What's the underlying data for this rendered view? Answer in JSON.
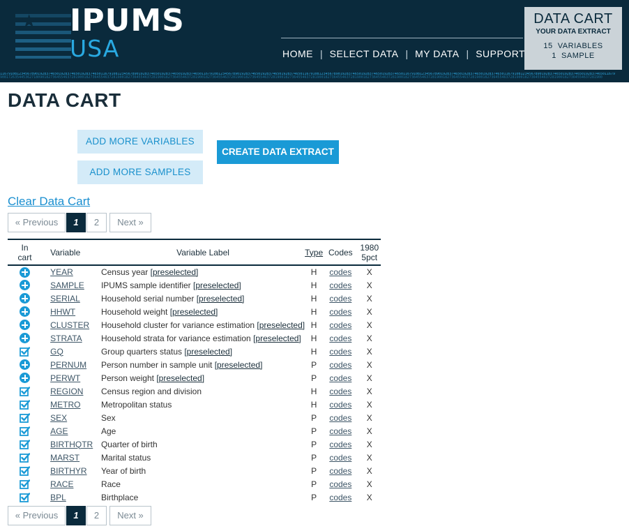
{
  "header": {
    "logo_title": "IPUMS",
    "logo_sub": "USA",
    "nav": [
      "HOME",
      "SELECT DATA",
      "MY DATA",
      "SUPPORT"
    ],
    "cart_box": {
      "title": "DATA CART",
      "subtitle": "YOUR DATA EXTRACT",
      "variables_count": "15",
      "variables_label": "VARIABLES",
      "samples_count": "1",
      "samples_label": "SAMPLE"
    }
  },
  "page": {
    "title": "DATA CART",
    "buttons": {
      "add_variables": "ADD MORE VARIABLES",
      "add_samples": "ADD MORE SAMPLES",
      "create_extract": "CREATE DATA EXTRACT"
    },
    "clear_cart": "Clear Data Cart",
    "pager": {
      "prev": "« Previous",
      "current": "1",
      "page2": "2",
      "next": "Next »"
    }
  },
  "table": {
    "headers": {
      "in_cart_1": "In",
      "in_cart_2": "cart",
      "variable": "Variable",
      "label": "Variable Label",
      "type": "Type",
      "codes": "Codes",
      "sample_1": "1980",
      "sample_2": "5pct"
    },
    "rows": [
      {
        "status": "add",
        "name": "YEAR",
        "label": "Census year",
        "preselected": "[preselected]",
        "type": "H",
        "codes": "codes",
        "sample": "X"
      },
      {
        "status": "add",
        "name": "SAMPLE",
        "label": "IPUMS sample identifier",
        "preselected": "[preselected]",
        "type": "H",
        "codes": "codes",
        "sample": "X"
      },
      {
        "status": "add",
        "name": "SERIAL",
        "label": "Household serial number",
        "preselected": "[preselected]",
        "type": "H",
        "codes": "codes",
        "sample": "X"
      },
      {
        "status": "add",
        "name": "HHWT",
        "label": "Household weight",
        "preselected": "[preselected]",
        "type": "H",
        "codes": "codes",
        "sample": "X"
      },
      {
        "status": "add",
        "name": "CLUSTER",
        "label": "Household cluster for variance estimation",
        "preselected": "[preselected]",
        "type": "H",
        "codes": "codes",
        "sample": "X"
      },
      {
        "status": "add",
        "name": "STRATA",
        "label": "Household strata for variance estimation",
        "preselected": "[preselected]",
        "type": "H",
        "codes": "codes",
        "sample": "X"
      },
      {
        "status": "check",
        "name": "GQ",
        "label": "Group quarters status",
        "preselected": "[preselected]",
        "type": "H",
        "codes": "codes",
        "sample": "X"
      },
      {
        "status": "add",
        "name": "PERNUM",
        "label": "Person number in sample unit",
        "preselected": "[preselected]",
        "type": "P",
        "codes": "codes",
        "sample": "X"
      },
      {
        "status": "add",
        "name": "PERWT",
        "label": "Person weight",
        "preselected": "[preselected]",
        "type": "P",
        "codes": "codes",
        "sample": "X"
      },
      {
        "status": "check",
        "name": "REGION",
        "label": "Census region and division",
        "preselected": "",
        "type": "H",
        "codes": "codes",
        "sample": "X"
      },
      {
        "status": "check",
        "name": "METRO",
        "label": "Metropolitan status",
        "preselected": "",
        "type": "H",
        "codes": "codes",
        "sample": "X"
      },
      {
        "status": "check",
        "name": "SEX",
        "label": "Sex",
        "preselected": "",
        "type": "P",
        "codes": "codes",
        "sample": "X"
      },
      {
        "status": "check",
        "name": "AGE",
        "label": "Age",
        "preselected": "",
        "type": "P",
        "codes": "codes",
        "sample": "X"
      },
      {
        "status": "check",
        "name": "BIRTHQTR",
        "label": "Quarter of birth",
        "preselected": "",
        "type": "P",
        "codes": "codes",
        "sample": "X"
      },
      {
        "status": "check",
        "name": "MARST",
        "label": "Marital status",
        "preselected": "",
        "type": "P",
        "codes": "codes",
        "sample": "X"
      },
      {
        "status": "check",
        "name": "BIRTHYR",
        "label": "Year of birth",
        "preselected": "",
        "type": "P",
        "codes": "codes",
        "sample": "X"
      },
      {
        "status": "check",
        "name": "RACE",
        "label": "Race",
        "preselected": "",
        "type": "P",
        "codes": "codes",
        "sample": "X"
      },
      {
        "status": "check",
        "name": "BPL",
        "label": "Birthplace",
        "preselected": "",
        "type": "P",
        "codes": "codes",
        "sample": "X"
      }
    ]
  },
  "icons": {
    "add": "plus-circle-icon",
    "check": "checkbox-checked-icon"
  },
  "colors": {
    "header_bg": "#0a2a3c",
    "accent": "#1a9ad6",
    "light_button_bg": "#d4ebf8"
  }
}
